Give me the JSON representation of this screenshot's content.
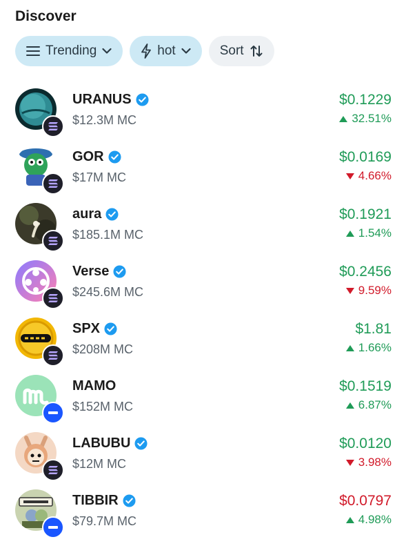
{
  "header": {
    "title": "Discover"
  },
  "filters": {
    "trending_label": "Trending",
    "hot_label": "hot",
    "sort_label": "Sort"
  },
  "colors": {
    "up": "#1f9b57",
    "down": "#d11a2a",
    "chip_blue": "#cde9f5",
    "chip_gray": "#eef1f4",
    "verified": "#1d9bf0"
  },
  "tokens": [
    {
      "name": "URANUS",
      "mc": "$12.3M MC",
      "price": "$0.1229",
      "change": "32.51%",
      "price_dir": "up",
      "change_dir": "up",
      "chain": "solana"
    },
    {
      "name": "GOR",
      "mc": "$17M MC",
      "price": "$0.0169",
      "change": "4.66%",
      "price_dir": "up",
      "change_dir": "down",
      "chain": "solana"
    },
    {
      "name": "aura",
      "mc": "$185.1M MC",
      "price": "$0.1921",
      "change": "1.54%",
      "price_dir": "up",
      "change_dir": "up",
      "chain": "solana"
    },
    {
      "name": "Verse",
      "mc": "$245.6M MC",
      "price": "$0.2456",
      "change": "9.59%",
      "price_dir": "up",
      "change_dir": "down",
      "chain": "solana"
    },
    {
      "name": "SPX",
      "mc": "$208M MC",
      "price": "$1.81",
      "change": "1.66%",
      "price_dir": "up",
      "change_dir": "up",
      "chain": "solana"
    },
    {
      "name": "MAMO",
      "mc": "$152M MC",
      "price": "$0.1519",
      "change": "6.87%",
      "price_dir": "up",
      "change_dir": "up",
      "chain": "base"
    },
    {
      "name": "LABUBU",
      "mc": "$12M MC",
      "price": "$0.0120",
      "change": "3.98%",
      "price_dir": "up",
      "change_dir": "down",
      "chain": "solana"
    },
    {
      "name": "TIBBIR",
      "mc": "$79.7M MC",
      "price": "$0.0797",
      "change": "4.98%",
      "price_dir": "down",
      "change_dir": "up",
      "chain": "base"
    }
  ]
}
